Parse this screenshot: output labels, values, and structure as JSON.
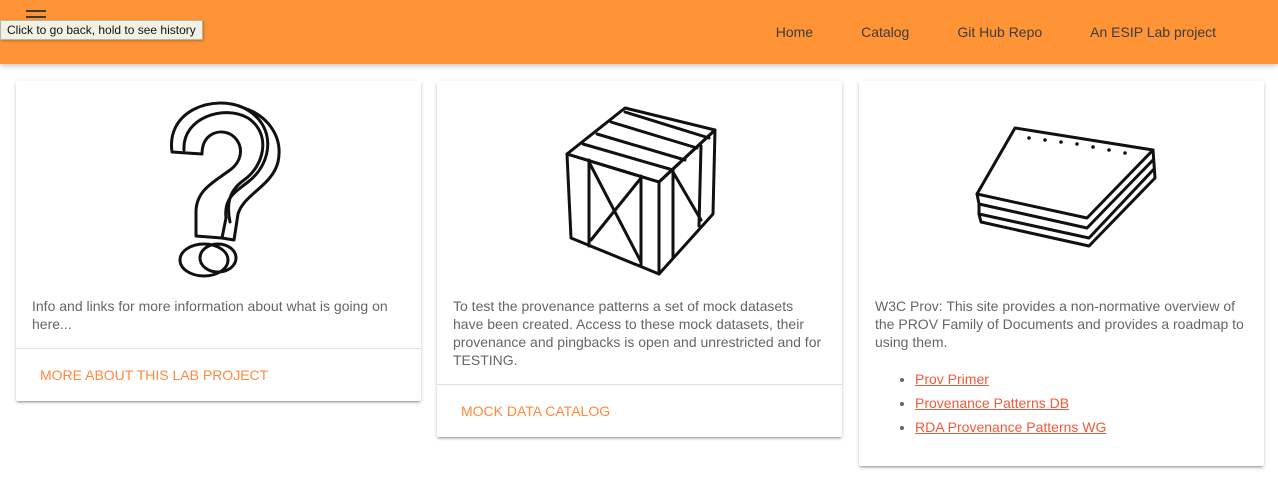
{
  "tooltip": {
    "text": "Click to go back, hold to see history"
  },
  "nav": {
    "links": [
      "Home",
      "Catalog",
      "Git Hub Repo",
      "An ESIP Lab project"
    ]
  },
  "cards": [
    {
      "icon": "question-mark-icon",
      "text": "Info and links for more information about what is going on here...",
      "action": "MORE ABOUT THIS LAB PROJECT"
    },
    {
      "icon": "crate-icon",
      "text": "To test the provenance patterns a set of mock datasets have been created. Access to these mock datasets, their provenance and pingbacks is open and unrestricted and for TESTING.",
      "action": "MOCK DATA CATALOG"
    },
    {
      "icon": "paper-stack-icon",
      "text": "W3C Prov: This site provides a non-normative overview of the PROV Family of Documents and provides a roadmap to using them.",
      "links": [
        "Prov Primer",
        "Provenance Patterns DB",
        "RDA Provenance Patterns WG"
      ]
    }
  ],
  "colors": {
    "navbar": "#ff9436",
    "action": "#ff8a3d",
    "link": "#ef5a3a"
  }
}
